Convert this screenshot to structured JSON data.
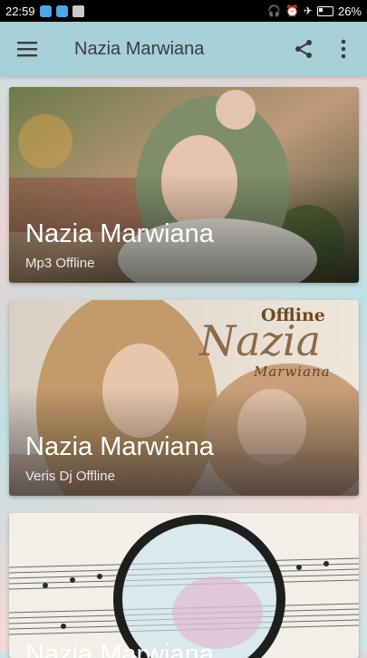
{
  "status_bar": {
    "time": "22:59",
    "battery": "26%",
    "icons": [
      "notification-icon-1",
      "notification-icon-2",
      "notification-icon-3",
      "headset-icon",
      "alarm-icon",
      "airplane-mode-icon",
      "battery-icon"
    ]
  },
  "app_bar": {
    "title": "Nazia Marwiana",
    "menu_icon": "menu-icon",
    "share_icon": "share-icon",
    "overflow_icon": "more-vert-icon"
  },
  "cards": [
    {
      "title": "Nazia Marwiana",
      "subtitle": "Mp3 Offline"
    },
    {
      "title": "Nazia Marwiana",
      "subtitle": "Veris Dj Offline",
      "overlay_badge": "Offline",
      "overlay_script": "Nazia",
      "overlay_sub": "Marwiana"
    },
    {
      "title": "Nazia Marwiana",
      "subtitle": ""
    }
  ],
  "colors": {
    "app_bar": "#a7cfd6",
    "status_bar": "#000000",
    "title_text": "#3c3c3c"
  }
}
